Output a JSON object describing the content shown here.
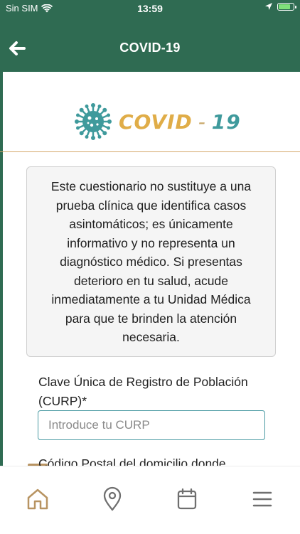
{
  "status_bar": {
    "carrier": "Sin SIM",
    "time": "13:59",
    "battery_level": 0.9
  },
  "header": {
    "title": "COVID-19",
    "back_icon": "arrow-left-icon"
  },
  "logo": {
    "icon": "virus-icon",
    "word": "COVID",
    "dash": "-",
    "number": "19"
  },
  "disclaimer": {
    "text": "Este cuestionario no sustituye a una prueba clínica que identifica casos asintomáticos; es únicamente informativo y no representa un diagnóstico médico. Si presentas deterioro en tu salud, acude inmediatamente a tu Unidad Médica para que te brinden la atención necesaria."
  },
  "form": {
    "curp_label": "Clave Única de Registro de Población (CURP)*",
    "curp_placeholder": "Introduce tu CURP",
    "curp_value": "",
    "postal_label": "Código Postal del domicilio donde"
  },
  "tabbar": {
    "items": [
      {
        "icon": "home-icon"
      },
      {
        "icon": "location-pin-icon"
      },
      {
        "icon": "calendar-icon"
      },
      {
        "icon": "menu-icon"
      }
    ]
  },
  "colors": {
    "header_green": "#2f6b52",
    "accent_gold": "#e0ad48",
    "accent_teal": "#3f9a9c",
    "tab_icon": "#b89462",
    "tab_icon_muted": "#6f6f6f"
  }
}
